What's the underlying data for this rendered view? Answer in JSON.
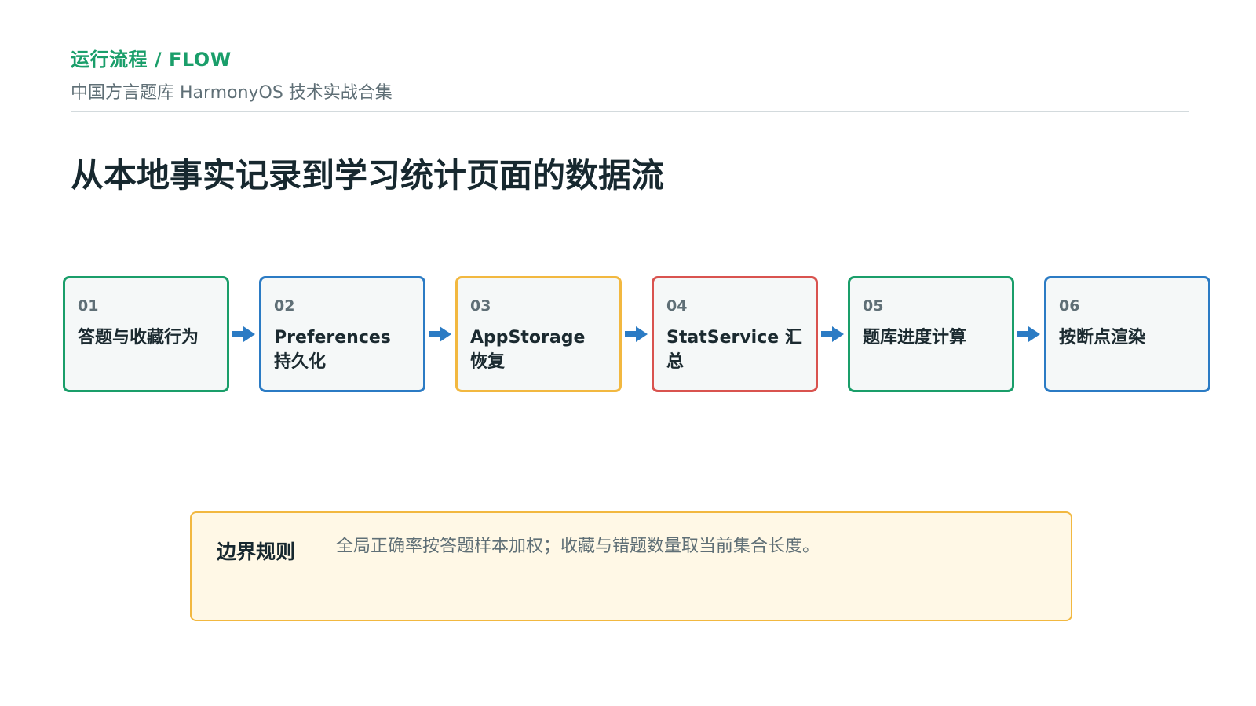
{
  "header": {
    "kicker": "运行流程 / FLOW",
    "subtitle": "中国方言题库 HarmonyOS 技术实战合集",
    "title": "从本地事实记录到学习统计页面的数据流"
  },
  "steps": [
    {
      "num": "01",
      "label": "答题与收藏行为",
      "color": "#1a9e6a"
    },
    {
      "num": "02",
      "label": "Preferences 持久化",
      "color": "#2b7bc4"
    },
    {
      "num": "03",
      "label": "AppStorage 恢复",
      "color": "#f2b840"
    },
    {
      "num": "04",
      "label": "StatService 汇总",
      "color": "#d9534f"
    },
    {
      "num": "05",
      "label": "题库进度计算",
      "color": "#1a9e6a"
    },
    {
      "num": "06",
      "label": "按断点渲染",
      "color": "#2b7bc4"
    }
  ],
  "arrow_color": "#2b7bc4",
  "note": {
    "label": "边界规则",
    "text": "全局正确率按答题样本加权；收藏与错题数量取当前集合长度。",
    "border_color": "#f2b840"
  }
}
